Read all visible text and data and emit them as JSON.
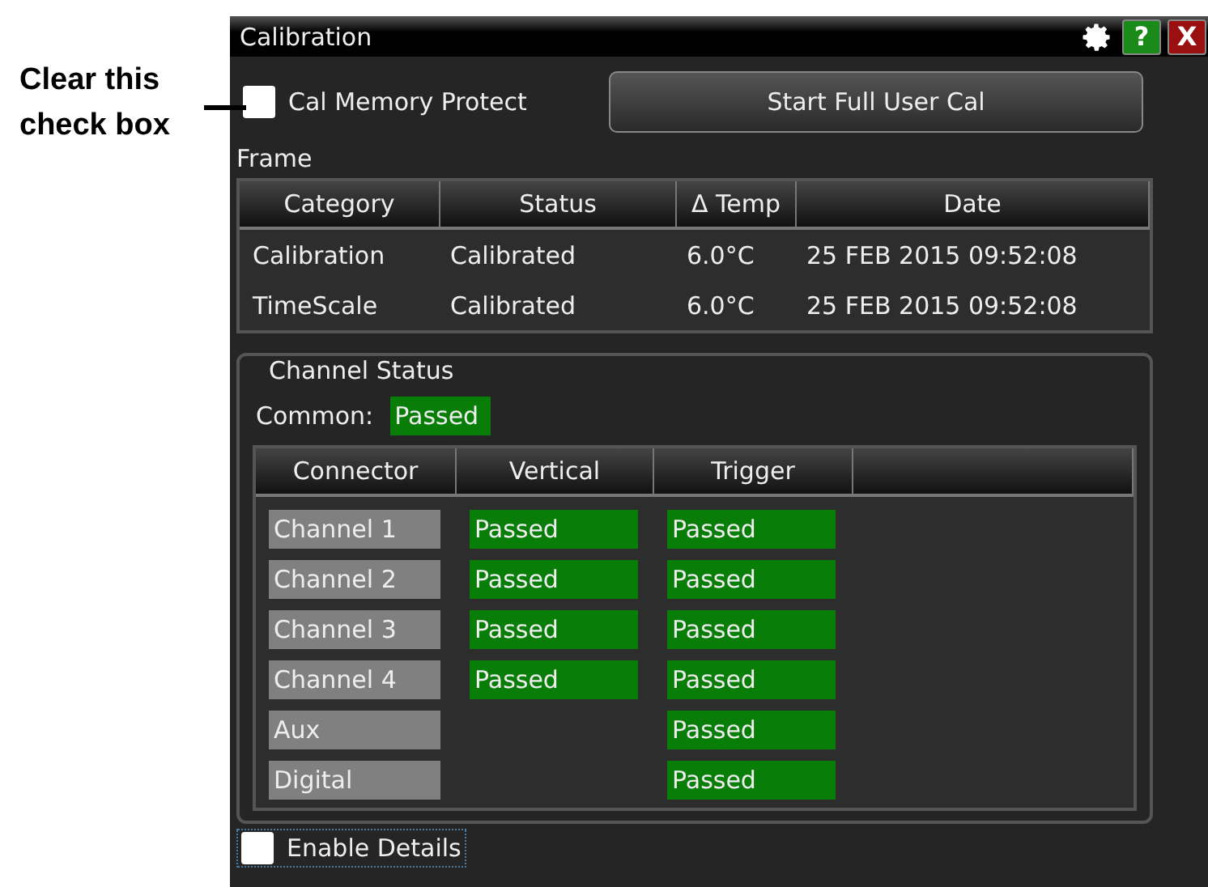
{
  "annotation": {
    "text": "Clear this check box"
  },
  "window": {
    "title": "Calibration",
    "help_label": "?",
    "close_label": "X"
  },
  "cal_memory_protect": {
    "label": "Cal Memory Protect",
    "checked": false
  },
  "start_button": {
    "label": "Start Full User Cal"
  },
  "frame": {
    "label": "Frame",
    "columns": [
      "Category",
      "Status",
      "Δ Temp",
      "Date"
    ],
    "rows": [
      [
        "Calibration",
        "Calibrated",
        "6.0°C",
        "25 FEB 2015 09:52:08"
      ],
      [
        "TimeScale",
        "Calibrated",
        "6.0°C",
        "25 FEB 2015 09:52:08"
      ]
    ]
  },
  "channel_status": {
    "title": "Channel Status",
    "common_label": "Common:",
    "common": "Passed",
    "columns": [
      "Connector",
      "Vertical",
      "Trigger"
    ],
    "rows": [
      {
        "connector": "Channel 1",
        "vertical": "Passed",
        "trigger": "Passed"
      },
      {
        "connector": "Channel 2",
        "vertical": "Passed",
        "trigger": "Passed"
      },
      {
        "connector": "Channel 3",
        "vertical": "Passed",
        "trigger": "Passed"
      },
      {
        "connector": "Channel 4",
        "vertical": "Passed",
        "trigger": "Passed"
      },
      {
        "connector": "Aux",
        "trigger": "Passed"
      },
      {
        "connector": "Digital",
        "trigger": "Passed"
      }
    ]
  },
  "enable_details": {
    "label": "Enable Details",
    "checked": false
  }
}
